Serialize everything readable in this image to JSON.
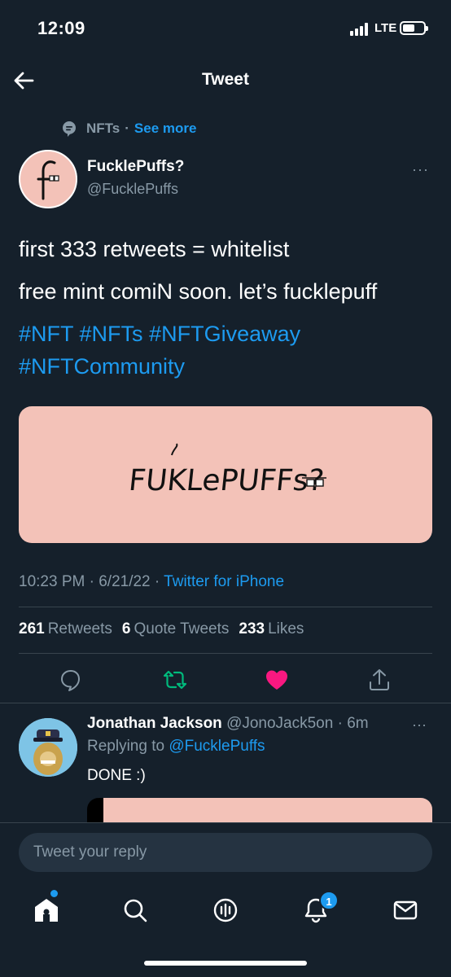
{
  "status_bar": {
    "time": "12:09",
    "network": "LTE"
  },
  "header": {
    "title": "Tweet"
  },
  "topic": {
    "label": "NFTs",
    "separator": "·",
    "see_more": "See more"
  },
  "tweet": {
    "display_name": "FucklePuffs?",
    "handle": "@FucklePuffs",
    "more": "···",
    "text_line1": "first 333 retweets = whitelist",
    "text_line2": "free mint comiN soon. let’s fucklepuff",
    "hashtags": [
      "#NFT",
      "#NFTs",
      "#NFTGiveaway",
      "#NFTCommunity"
    ],
    "media_logo": "FUKLePUFFs?",
    "time": "10:23 PM",
    "date": "6/21/22",
    "sep": "·",
    "source": "Twitter for iPhone",
    "retweets_count": "261",
    "retweets_label": "Retweets",
    "quotes_count": "6",
    "quotes_label": "Quote Tweets",
    "likes_count": "233",
    "likes_label": "Likes"
  },
  "reply": {
    "name": "Jonathan Jackson",
    "handle": "@JonoJack5on",
    "time": "· 6m",
    "replying_prefix": "Replying to",
    "replying_to": "@FucklePuffs",
    "text": "DONE :)",
    "more": "···"
  },
  "composer": {
    "placeholder": "Tweet your reply"
  },
  "tabbar": {
    "notifications_badge": "1"
  },
  "colors": {
    "background": "#15202b",
    "accent": "#1d9bf0",
    "like": "#f91880",
    "retweet": "#00ba7c",
    "media_bg": "#f3c2b8"
  }
}
